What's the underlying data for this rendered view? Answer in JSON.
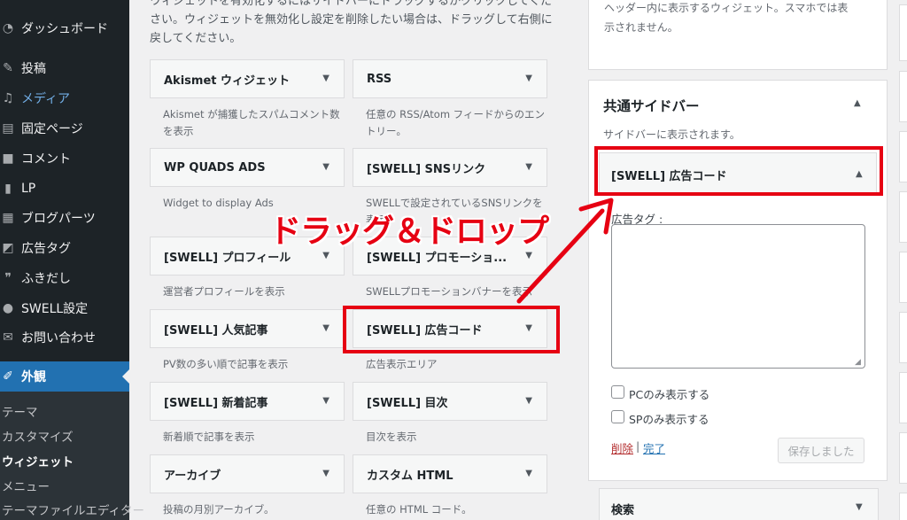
{
  "menu": {
    "items": [
      {
        "label": "ダッシュボード",
        "icon": "dashboard-icon"
      },
      {
        "label": "投稿",
        "icon": "pushpin-icon"
      },
      {
        "label": "メディア",
        "icon": "media-icon"
      },
      {
        "label": "固定ページ",
        "icon": "page-icon"
      },
      {
        "label": "コメント",
        "icon": "comment-icon"
      },
      {
        "label": "LP",
        "icon": "document-icon"
      },
      {
        "label": "ブログパーツ",
        "icon": "grid-icon"
      },
      {
        "label": "広告タグ",
        "icon": "megaphone-icon"
      },
      {
        "label": "ふきだし",
        "icon": "speech-bubble-icon"
      },
      {
        "label": "SWELL設定",
        "icon": "swell-icon"
      },
      {
        "label": "お問い合わせ",
        "icon": "mail-icon"
      }
    ],
    "active": {
      "label": "外観",
      "icon": "paintbrush-icon"
    },
    "submenu": [
      "テーマ",
      "カスタマイズ",
      "ウィジェット",
      "メニュー",
      "テーマファイルエディター"
    ]
  },
  "available": {
    "desc_lines": [
      "ウィジェットを有効化するにはサイドバーにドラッグするかクリックしてくだ",
      "さい。ウィジェットを無効化し設定を削除したい場合は、ドラッグして右側に",
      "戻してください。"
    ],
    "widgets": [
      {
        "title": "Akismet ウィジェット",
        "desc": "Akismet が捕獲したスパムコメント数を表示"
      },
      {
        "title": "RSS",
        "desc": "任意の RSS/Atom フィードからのエントリー。"
      },
      {
        "title": "WP QUADS ADS",
        "desc": "Widget to display Ads"
      },
      {
        "title": "[SWELL] SNSリンク",
        "desc": "SWELLで設定されているSNSリンクを表示"
      },
      {
        "title": "[SWELL] プロフィール",
        "desc": "運営者プロフィールを表示"
      },
      {
        "title": "[SWELL] プロモーショ...",
        "desc": "SWELLプロモーションバナーを表示"
      },
      {
        "title": "[SWELL] 人気記事",
        "desc": "PV数の多い順で記事を表示"
      },
      {
        "title": "[SWELL] 広告コード",
        "desc": "広告表示エリア"
      },
      {
        "title": "[SWELL] 新着記事",
        "desc": "新着順で記事を表示"
      },
      {
        "title": "[SWELL] 目次",
        "desc": "目次を表示"
      },
      {
        "title": "アーカイブ",
        "desc": "投稿の月別アーカイブ。"
      },
      {
        "title": "カスタム HTML",
        "desc": "任意の HTML コード。"
      }
    ]
  },
  "header_area": {
    "desc_lines": [
      "ヘッダー内に表示するウィジェット。スマホでは表",
      "示されません。"
    ]
  },
  "sidebar": {
    "title": "共通サイドバー",
    "desc": "サイドバーに表示されます。",
    "widget": {
      "title": "[SWELL] 広告コード",
      "field_label": "広告タグ :",
      "field_value": "",
      "checkbox_pc": "PCのみ表示する",
      "checkbox_sp": "SPのみ表示する",
      "delete_label": "削除",
      "separator": "|",
      "done_label": "完了",
      "save_label": "保存しました"
    }
  },
  "search_widget": {
    "title": "検索"
  },
  "annotation": {
    "text": "ドラッグ＆ドロップ",
    "color": "#e60012"
  }
}
